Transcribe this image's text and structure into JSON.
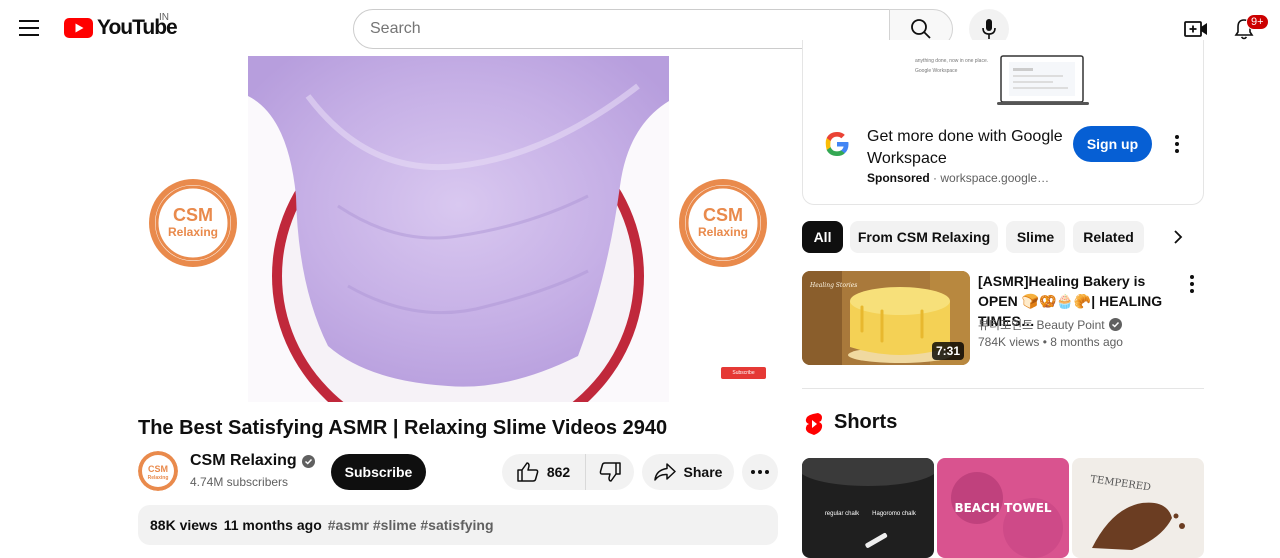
{
  "header": {
    "logo_text": "YouTube",
    "country_code": "IN",
    "search_placeholder": "Search",
    "notification_count": "9+"
  },
  "player": {
    "watermark_line1": "CSM",
    "watermark_line2": "Relaxing",
    "subscribe_watermark": "Subscribe"
  },
  "video": {
    "title": "The Best Satisfying ASMR | Relaxing Slime Videos 2940",
    "channel_name": "CSM Relaxing",
    "subscribers": "4.74M subscribers",
    "subscribe_label": "Subscribe",
    "like_count": "862",
    "share_label": "Share",
    "views": "88K views",
    "age": "11 months ago",
    "hashtags": "#asmr #slime #satisfying"
  },
  "ad": {
    "preview_text_1": "anything done, now in one place.",
    "preview_text_2": "Google Workspace",
    "title": "Get more done with Google Workspace",
    "sponsored_label": "Sponsored",
    "domain": "workspace.google…",
    "cta_label": "Sign up"
  },
  "chips": [
    "All",
    "From CSM Relaxing",
    "Slime",
    "Related"
  ],
  "related": {
    "title": "[ASMR]Healing Bakery is OPEN 🍞🥨🧁🥐| HEALING TIMES…",
    "channel": "뷰티포인트 Beauty Point",
    "views": "784K views",
    "age": "8 months ago",
    "duration": "7:31",
    "thumb_overlay": "Healing Stories"
  },
  "shorts": {
    "title": "Shorts",
    "items": [
      {
        "label_a": "regular chalk",
        "label_b": "Hagoromo chalk"
      },
      {
        "label": "BEACH TOWEL"
      },
      {
        "label": "TEMPERED"
      }
    ]
  },
  "colors": {
    "brand_red": "#ff0000",
    "subscribe_black": "#0f0f0f",
    "ad_cta_blue": "#065fd4",
    "notif_badge": "#cc0000",
    "watermark_orange": "#e98a4c",
    "slime_purple": "#c9b3e8"
  }
}
